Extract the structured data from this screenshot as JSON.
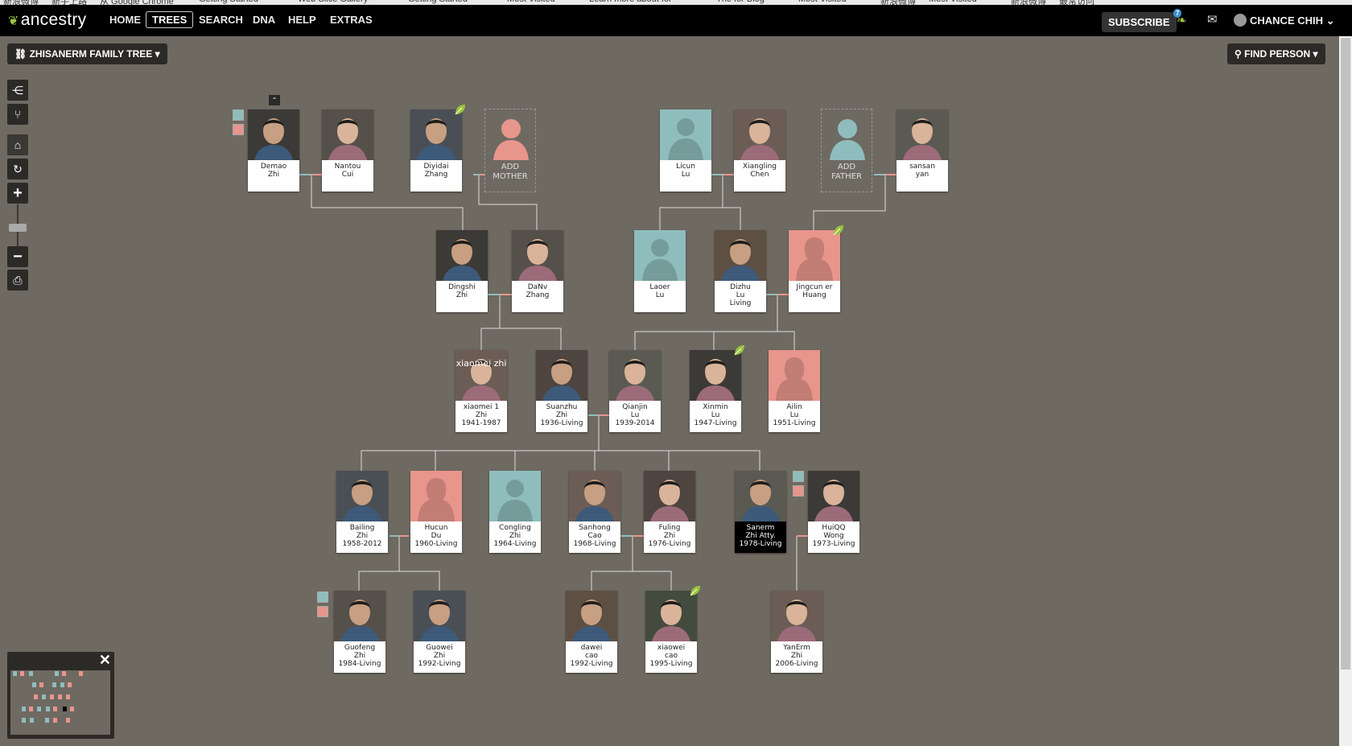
{
  "browser": {
    "bookmarks": [
      "新浪微博",
      "新手上路",
      "从 Google Chrome",
      "Getting Started",
      "Web Slice Gallery",
      "Getting Started",
      "Most Visited",
      "Learn more about for",
      "The for Blog",
      "Most Visited",
      "新浪微博",
      "Most Visited",
      "新浪微博",
      "最常访问"
    ]
  },
  "nav": {
    "logo": "ancestry",
    "items": [
      "HOME",
      "TREES",
      "SEARCH",
      "DNA",
      "HELP",
      "EXTRAS"
    ],
    "active": "TREES",
    "subscribe": "SUBSCRIBE",
    "hint_count": "7",
    "user": "CHANCE CHIH"
  },
  "tree": {
    "name": "ZHISANERM FAMILY TREE",
    "find_person": "FIND PERSON"
  },
  "people": [
    {
      "key": "demao",
      "name": [
        "Demao",
        "Zhi"
      ],
      "gender": "m",
      "photo": true
    },
    {
      "key": "nantou",
      "name": [
        "Nantou",
        "Cui"
      ],
      "gender": "f",
      "photo": true
    },
    {
      "key": "diyidai",
      "name": [
        "Diyidai",
        "Zhang"
      ],
      "gender": "m",
      "photo": true,
      "hint": true
    },
    {
      "key": "addmother",
      "name": [
        "ADD",
        "MOTHER"
      ],
      "gender": "f",
      "add": true
    },
    {
      "key": "licun",
      "name": [
        "Licun",
        "Lu"
      ],
      "gender": "m"
    },
    {
      "key": "xiangling",
      "name": [
        "Xiangling",
        "Chen"
      ],
      "gender": "f",
      "photo": true
    },
    {
      "key": "addfather",
      "name": [
        "ADD",
        "FATHER"
      ],
      "gender": "m",
      "add": true
    },
    {
      "key": "sansan",
      "name": [
        "sansan",
        "yan"
      ],
      "gender": "f",
      "photo": true
    },
    {
      "key": "dingshi",
      "name": [
        "Dingshi",
        "Zhi"
      ],
      "gender": "m",
      "photo": true
    },
    {
      "key": "danv",
      "name": [
        "DaNv",
        "Zhang"
      ],
      "gender": "f",
      "photo": true
    },
    {
      "key": "laoer",
      "name": [
        "Laoer",
        "Lu"
      ],
      "gender": "m"
    },
    {
      "key": "dizhu",
      "name": [
        "Dizhu",
        "Lu",
        "Living"
      ],
      "gender": "m",
      "photo": true
    },
    {
      "key": "jingcun",
      "name": [
        "Jingcun er",
        "Huang"
      ],
      "gender": "f",
      "hint": true
    },
    {
      "key": "xiaomei",
      "name": [
        "xiaomei 1",
        "Zhi",
        "1941-1987"
      ],
      "gender": "f",
      "photo": true,
      "overlay": "xiaomei zhi"
    },
    {
      "key": "suanzhu",
      "name": [
        "Suanzhu",
        "Zhi",
        "1936-Living"
      ],
      "gender": "m",
      "photo": true
    },
    {
      "key": "qianjin",
      "name": [
        "Qianjin",
        "Lu",
        "1939-2014"
      ],
      "gender": "f",
      "photo": true
    },
    {
      "key": "xinmin",
      "name": [
        "Xinmin",
        "Lu",
        "1947-Living"
      ],
      "gender": "f",
      "photo": true,
      "hint": true
    },
    {
      "key": "ailin",
      "name": [
        "Ailin",
        "Lu",
        "1951-Living"
      ],
      "gender": "f"
    },
    {
      "key": "bailing",
      "name": [
        "Bailing",
        "Zhi",
        "1958-2012"
      ],
      "gender": "m",
      "photo": true
    },
    {
      "key": "hucun",
      "name": [
        "Hucun",
        "Du",
        "1960-Living"
      ],
      "gender": "f"
    },
    {
      "key": "congling",
      "name": [
        "Congling",
        "Zhi",
        "1964-Living"
      ],
      "gender": "m"
    },
    {
      "key": "sanhong",
      "name": [
        "Sanhong",
        "Cao",
        "1968-Living"
      ],
      "gender": "m",
      "photo": true
    },
    {
      "key": "fuling",
      "name": [
        "Fuling",
        "Zhi",
        "1976-Living"
      ],
      "gender": "f",
      "photo": true
    },
    {
      "key": "sanerm",
      "name": [
        "Sanerm",
        "Zhi Atty.",
        "1978-Living"
      ],
      "gender": "m",
      "photo": true,
      "selected": true
    },
    {
      "key": "huiqq",
      "name": [
        "HuiQQ",
        "Wong",
        "1973-Living"
      ],
      "gender": "f",
      "photo": true
    },
    {
      "key": "guofeng",
      "name": [
        "Guofeng",
        "Zhi",
        "1984-Living"
      ],
      "gender": "m",
      "photo": true
    },
    {
      "key": "guowei",
      "name": [
        "Guowei",
        "Zhi",
        "1992-Living"
      ],
      "gender": "m",
      "photo": true
    },
    {
      "key": "dawei",
      "name": [
        "dawei",
        "cao",
        "1992-Living"
      ],
      "gender": "m",
      "photo": true
    },
    {
      "key": "xiaowei",
      "name": [
        "xiaowei",
        "cao",
        "1995-Living"
      ],
      "gender": "f",
      "photo": true,
      "hint": true
    },
    {
      "key": "yanerm",
      "name": [
        "YanErm",
        "Zhi",
        "2006-Living"
      ],
      "gender": "f",
      "photo": true
    }
  ],
  "colors": {
    "background": "#6e6a62",
    "male": "#8fbdbd",
    "female": "#e8958c",
    "hint": "#9bc53d"
  }
}
